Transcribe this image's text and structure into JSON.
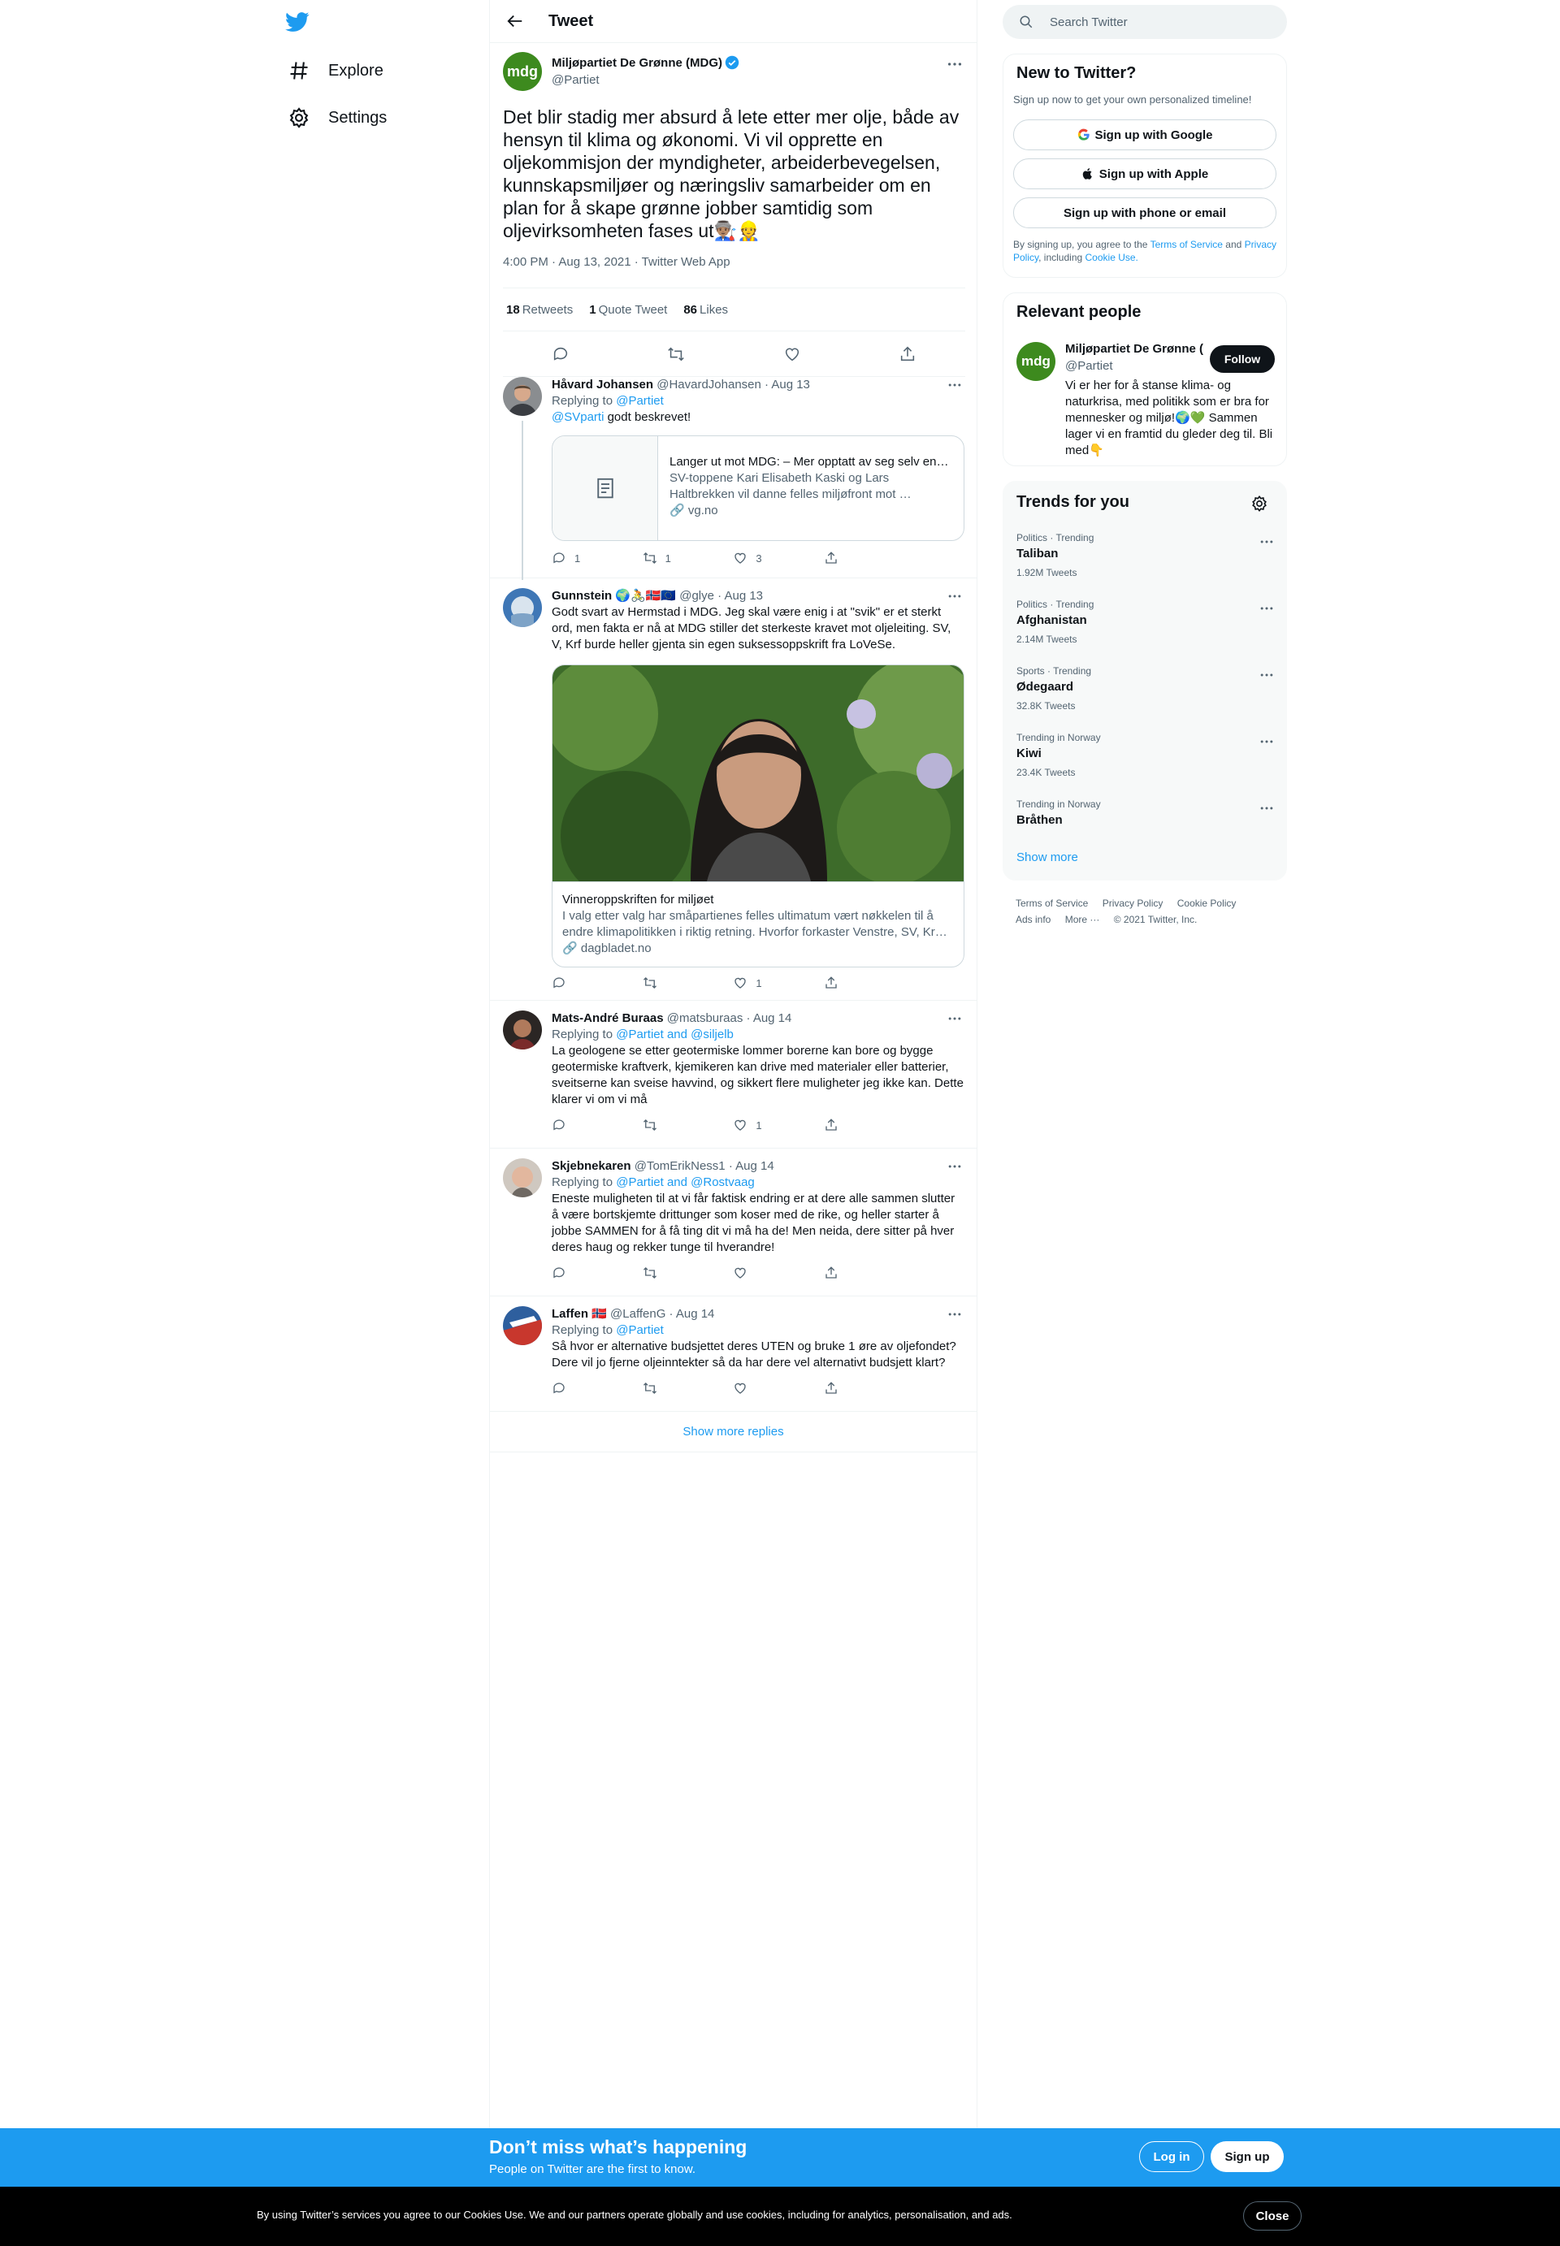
{
  "nav": {
    "logo": "twitter-bird-icon",
    "items": [
      {
        "label": "Explore",
        "icon": "hashtag-icon"
      },
      {
        "label": "Settings",
        "icon": "gear-icon"
      }
    ]
  },
  "main": {
    "title": "Tweet",
    "tweet": {
      "avatar_text": "mdg",
      "name": "Miljøpartiet De Grønne (MDG)",
      "handle": "@Partiet",
      "text": "Det blir stadig mer absurd å lete etter mer olje, både av hensyn til klima og økonomi. Vi vil opprette en oljekommisjon der myndigheter, arbeiderbevegelsen, kunnskapsmiljøer og næringsliv samarbeider om en plan for å skape grønne jobber samtidig som oljevirksomheten fases ut👨🏽‍🏭👷",
      "meta": "4:00 PM · Aug 13, 2021 · Twitter Web App",
      "retweets": "18",
      "retweets_label": "Retweets",
      "quotes": "1",
      "quotes_label": "Quote Tweet",
      "likes": "86",
      "likes_label": "Likes"
    },
    "replies": [
      {
        "name": "Håvard Johansen",
        "handle": "@HavardJohansen · Aug 13",
        "replying_prefix": "Replying to",
        "replying_to": "@Partiet",
        "mention": "@SVparti",
        "text": "godt beskrevet!",
        "card_title": "Langer ut mot MDG: – Mer opptatt av seg selv enn …",
        "card_desc": "SV-toppene Kari Elisabeth Kaski og Lars Haltbrekken vil danne felles miljøfront mot …",
        "card_domain": "vg.no",
        "replies": "1",
        "retweets": "1",
        "likes": "3"
      },
      {
        "name": "Gunnstein",
        "name_emoji": "🌍🚴🇳🇴🇪🇺",
        "handle": "@glye · Aug 13",
        "text": "Godt svart av Hermstad i MDG. Jeg skal være enig i at \"svik\" er et sterkt ord, men fakta er nå at MDG stiller det sterkeste kravet mot oljeleiting. SV, V, Krf burde heller gjenta sin egen suksessoppskrift fra LoVeSe.",
        "card_title": "Vinneroppskriften for miljøet",
        "card_desc": "I valg etter valg har småpartienes felles ultimatum vært nøkkelen til å endre klimapolitikken i riktig retning. Hvorfor forkaster Venstre, SV, Kr…",
        "card_domain": "dagbladet.no",
        "likes": "1"
      },
      {
        "name": "Mats-André Buraas",
        "handle": "@matsburaas · Aug 14",
        "replying_prefix": "Replying to",
        "replying_to": "@Partiet and @siljelb",
        "text": "La geologene se etter geotermiske lommer borerne kan bore og bygge geotermiske kraftverk, kjemikeren kan drive med materialer eller batterier, sveitserne kan sveise havvind, og sikkert flere muligheter jeg ikke kan. Dette klarer vi om vi må",
        "likes": "1"
      },
      {
        "name": "Skjebnekaren",
        "handle": "@TomErikNess1 · Aug 14",
        "replying_prefix": "Replying to",
        "replying_to": "@Partiet and @Rostvaag",
        "text": "Eneste muligheten til at vi får faktisk endring er at dere alle sammen slutter å være bortskjemte drittunger som koser med de rike, og heller starter å jobbe SAMMEN for å få ting dit vi må ha de! Men neida, dere sitter på hver deres haug og rekker tunge til hverandre!"
      },
      {
        "name": "Laffen",
        "name_emoji": "🇳🇴",
        "handle": "@LaffenG · Aug 14",
        "replying_prefix": "Replying to",
        "replying_to": "@Partiet",
        "text": "Så hvor er alternative budsjettet deres UTEN og bruke 1 øre av oljefondet? Dere vil jo fjerne oljeinntekter så da har dere vel alternativt budsjett klart?"
      }
    ],
    "show_more_replies": "Show more replies"
  },
  "sidebar": {
    "search_placeholder": "Search Twitter",
    "new_to_twitter": {
      "title": "New to Twitter?",
      "subtitle": "Sign up now to get your own personalized timeline!",
      "google": "Sign up with Google",
      "apple": "Sign up with Apple",
      "phone": "Sign up with phone or email",
      "legal_1": "By signing up, you agree to the",
      "terms": "Terms of Service",
      "legal_2": "and",
      "privacy": "Privacy Policy",
      "legal_3": ", including",
      "cookie": "Cookie Use."
    },
    "relevant": {
      "title": "Relevant people",
      "avatar_text": "mdg",
      "name": "Miljøpartiet De Grønne (MDG)",
      "handle": "@Partiet",
      "follow": "Follow",
      "bio": "Vi er her for å stanse klima- og naturkrisa, med politikk som er bra for mennesker og miljø!🌍💚 Sammen lager vi en framtid du gleder deg til. Bli med👇"
    },
    "trends": {
      "title": "Trends for you",
      "items": [
        {
          "context": "Politics · Trending",
          "name": "Taliban",
          "count": "1.92M Tweets"
        },
        {
          "context": "Politics · Trending",
          "name": "Afghanistan",
          "count": "2.14M Tweets"
        },
        {
          "context": "Sports · Trending",
          "name": "Ødegaard",
          "count": "32.8K Tweets"
        },
        {
          "context": "Trending in Norway",
          "name": "Kiwi",
          "count": "23.4K Tweets"
        },
        {
          "context": "Trending in Norway",
          "name": "Bråthen",
          "count": ""
        }
      ],
      "show_more": "Show more"
    },
    "footer": [
      "Terms of Service",
      "Privacy Policy",
      "Cookie Policy",
      "Ads info",
      "More ···",
      "© 2021 Twitter, Inc."
    ]
  },
  "bottom_bar": {
    "headline": "Don’t miss what’s happening",
    "subline": "People on Twitter are the first to know.",
    "login": "Log in",
    "signup": "Sign up"
  },
  "cookie_bar": {
    "text": "By using Twitter’s services you agree to our Cookies Use. We and our partners operate globally and use cookies, including for analytics, personalisation, and ads.",
    "close": "Close"
  },
  "colors": {
    "accent": "#1d9bf0",
    "text": "#0f1419",
    "muted": "#536471",
    "mdg_green": "#3d8a1e"
  }
}
